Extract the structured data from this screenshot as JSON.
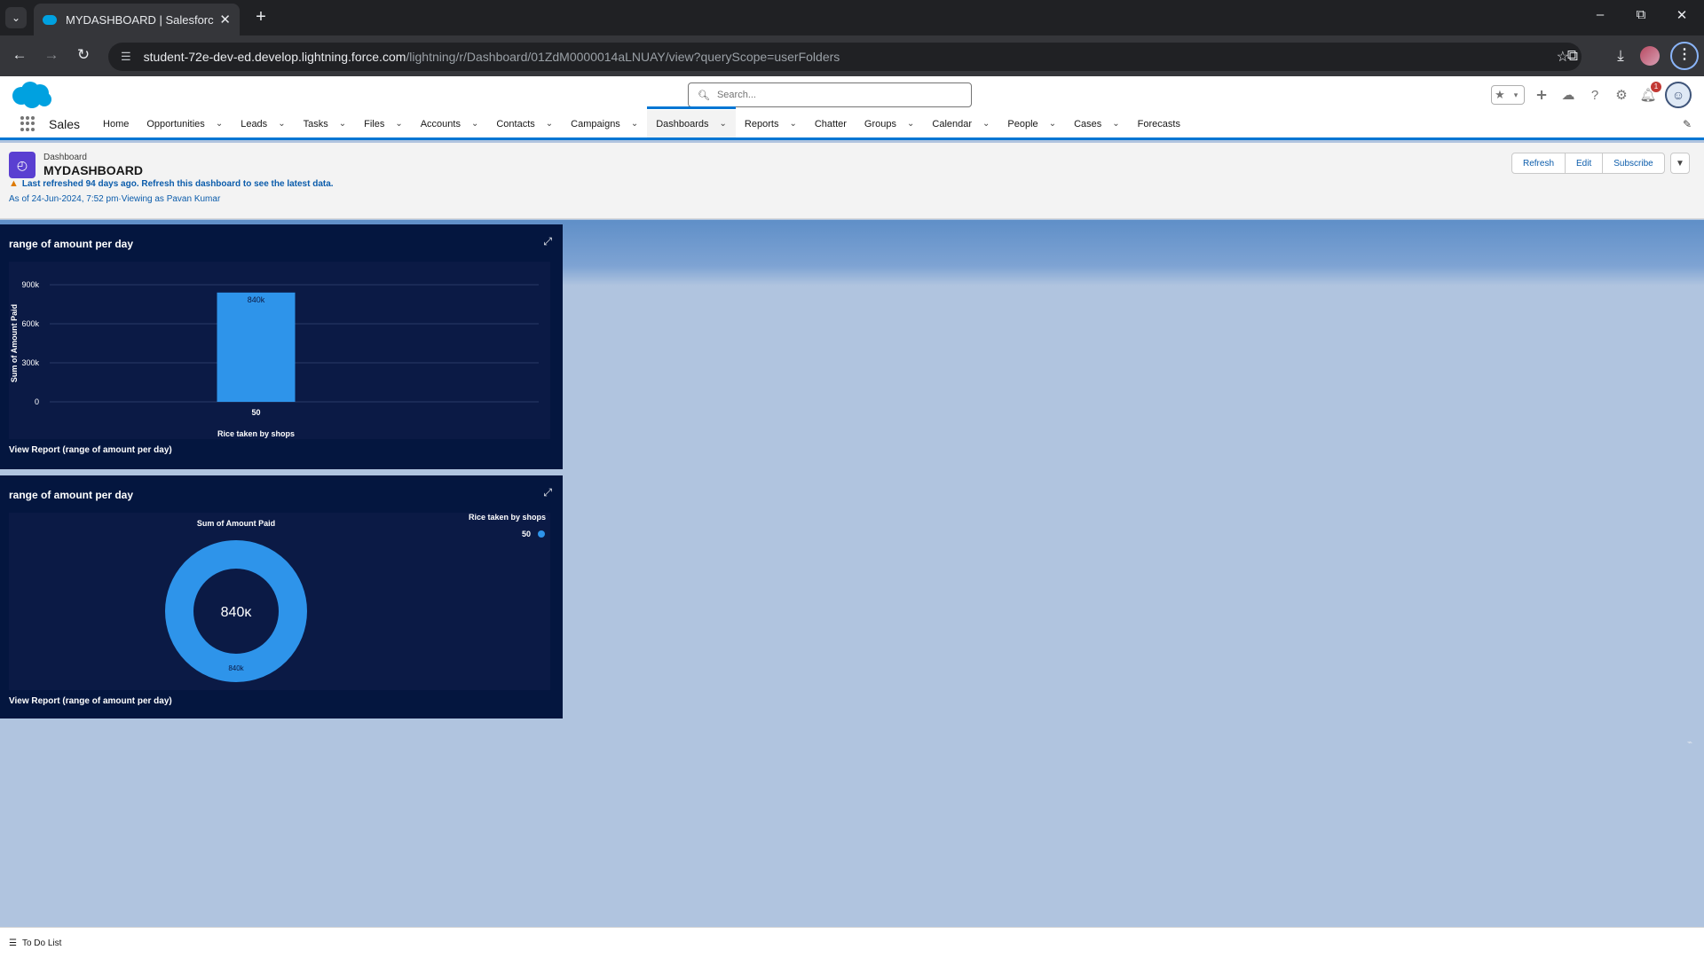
{
  "browser": {
    "tab_title": "MYDASHBOARD | Salesforce",
    "url_host": "student-72e-dev-ed.develop.lightning.force.com",
    "url_path": "/lightning/r/Dashboard/01ZdM0000014aLNUAY/view?queryScope=userFolders",
    "notification_count": "1"
  },
  "header": {
    "search_placeholder": "Search...",
    "app_name": "Sales"
  },
  "nav": {
    "items": [
      {
        "label": "Home",
        "has_menu": false
      },
      {
        "label": "Opportunities",
        "has_menu": true
      },
      {
        "label": "Leads",
        "has_menu": true
      },
      {
        "label": "Tasks",
        "has_menu": true
      },
      {
        "label": "Files",
        "has_menu": true
      },
      {
        "label": "Accounts",
        "has_menu": true
      },
      {
        "label": "Contacts",
        "has_menu": true
      },
      {
        "label": "Campaigns",
        "has_menu": true
      },
      {
        "label": "Dashboards",
        "has_menu": true,
        "active": true
      },
      {
        "label": "Reports",
        "has_menu": true
      },
      {
        "label": "Chatter",
        "has_menu": false
      },
      {
        "label": "Groups",
        "has_menu": true
      },
      {
        "label": "Calendar",
        "has_menu": true
      },
      {
        "label": "People",
        "has_menu": true
      },
      {
        "label": "Cases",
        "has_menu": true
      },
      {
        "label": "Forecasts",
        "has_menu": false
      }
    ]
  },
  "page": {
    "object_type": "Dashboard",
    "title": "MYDASHBOARD",
    "warning": "Last refreshed 94 days ago. Refresh this dashboard to see the latest data.",
    "as_of": "As of 24-Jun-2024, 7:52 pm·Viewing as Pavan Kumar",
    "buttons": {
      "refresh": "Refresh",
      "edit": "Edit",
      "subscribe": "Subscribe"
    }
  },
  "widgets": [
    {
      "title": "range of amount per day",
      "view_report": "View Report (range of amount per day)"
    },
    {
      "title": "range of amount per day",
      "view_report": "View Report (range of amount per day)"
    }
  ],
  "chart_data": [
    {
      "type": "bar",
      "categories": [
        "50"
      ],
      "values": [
        840000
      ],
      "data_labels": [
        "840k"
      ],
      "xlabel": "Rice taken by shops",
      "ylabel": "Sum of Amount Paid",
      "ylim": [
        0,
        900000
      ],
      "yticks": [
        "0",
        "300k",
        "600k",
        "900k"
      ],
      "grid": true,
      "color": "#2e94ea"
    },
    {
      "type": "pie",
      "subtype": "donut",
      "title": "Sum of Amount Paid",
      "categories": [
        "50"
      ],
      "values": [
        840000
      ],
      "center_label": "840κ",
      "data_labels": [
        "840k"
      ],
      "legend_title": "Rice taken by shops",
      "legend_position": "top-right",
      "color": "#2e94ea"
    }
  ],
  "utility_bar": {
    "todo_label": "To Do List"
  },
  "colors": {
    "brand": "#0176d3",
    "widget_bg": "#04163f",
    "bar": "#2e94ea"
  }
}
